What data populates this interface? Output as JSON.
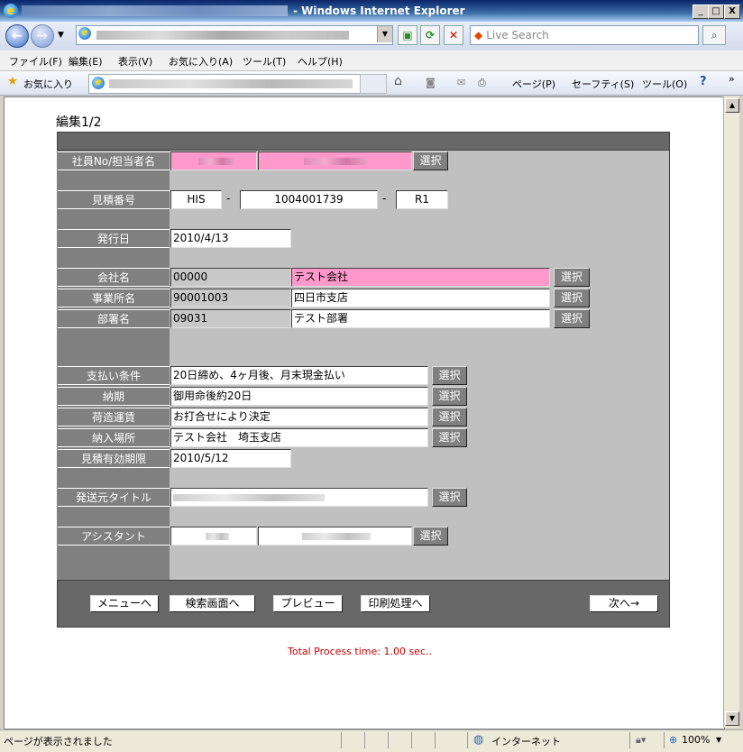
{
  "window": {
    "title": "- Windows Internet Explorer",
    "min": "_",
    "max": "□",
    "close": "X"
  },
  "navbar": {
    "search_placeholder": "Live Search"
  },
  "menu": [
    "ファイル(F)",
    "編集(E)",
    "表示(V)",
    "お気に入り(A)",
    "ツール(T)",
    "ヘルプ(H)"
  ],
  "favbar": {
    "favorites": "お気に入り",
    "page": "ページ(P)",
    "safety": "セーフティ(S)",
    "tools": "ツール(O)"
  },
  "page": {
    "title": "編集1/2"
  },
  "form": {
    "employee_label": "社員No/担当者名",
    "quote_no_label": "見積番号",
    "quote_no_prefix": "HIS",
    "quote_no_number": "1004001739",
    "quote_no_rev": "R1",
    "issue_date_label": "発行日",
    "issue_date": "2010/4/13",
    "company_label": "会社名",
    "company_code": "00000",
    "company_name": "テスト会社",
    "office_label": "事業所名",
    "office_code": "90001003",
    "office_name": "四日市支店",
    "dept_label": "部署名",
    "dept_code": "09031",
    "dept_name": "テスト部署",
    "payment_label": "支払い条件",
    "payment": "20日締め、4ヶ月後、月末現金払い",
    "delivery_label": "納期",
    "delivery": "御用命後約20日",
    "shipping_label": "荷造運賃",
    "shipping": "お打合せにより決定",
    "place_label": "納入場所",
    "place": "テスト会社　埼玉支店",
    "validity_label": "見積有効期限",
    "validity": "2010/5/12",
    "sender_label": "発送元タイトル",
    "assistant_label": "アシスタント",
    "select": "選択",
    "dash": "-"
  },
  "footer": {
    "menu": "メニューへ",
    "search": "検索画面へ",
    "preview": "プレビュー",
    "print": "印刷処理へ",
    "next": "次へ→"
  },
  "process_time": "Total Process time: 1.00 sec..",
  "status": {
    "text": "ページが表示されました",
    "zone": "インターネット",
    "zoom": "100%"
  }
}
